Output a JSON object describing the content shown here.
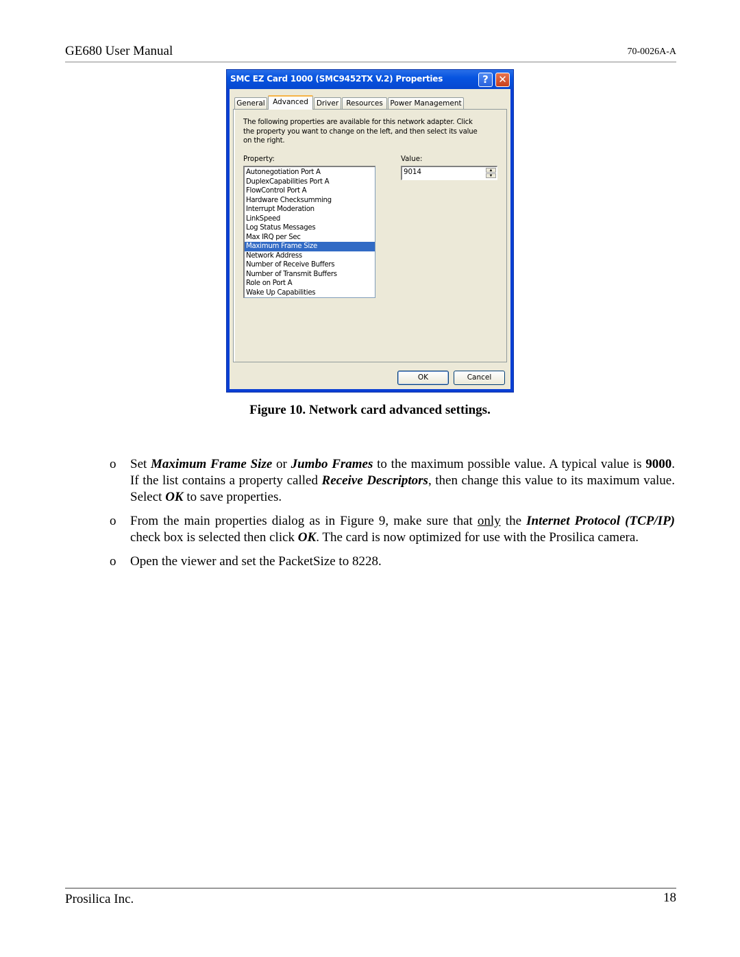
{
  "header": {
    "title": "GE680 User Manual",
    "doc_number": "70-0026A-A"
  },
  "footer": {
    "company": "Prosilica Inc.",
    "page_number": "18"
  },
  "dialog": {
    "title": "SMC EZ Card 1000 (SMC9452TX V.2) Properties",
    "help_icon": "question-mark",
    "close_icon": "x",
    "tabs": [
      {
        "label": "General",
        "active": false
      },
      {
        "label": "Advanced",
        "active": true
      },
      {
        "label": "Driver",
        "active": false
      },
      {
        "label": "Resources",
        "active": false
      },
      {
        "label": "Power Management",
        "active": false
      }
    ],
    "description": "The following properties are available for this network adapter. Click the property you want to change on the left, and then select its value on the right.",
    "property_label": "Property:",
    "value_label": "Value:",
    "properties": [
      "Autonegotiation Port A",
      "DuplexCapabilities Port A",
      "FlowControl Port A",
      "Hardware Checksumming",
      "Interrupt Moderation",
      "LinkSpeed",
      "Log Status Messages",
      "Max IRQ per Sec",
      "Maximum Frame Size",
      "Network Address",
      "Number of Receive Buffers",
      "Number of Transmit Buffers",
      "Role on Port A",
      "Wake Up Capabilities"
    ],
    "selected_property": "Maximum Frame Size",
    "value": "9014",
    "ok_label": "OK",
    "cancel_label": "Cancel"
  },
  "caption": "Figure 10. Network card advanced settings.",
  "bullets": {
    "marker": "o",
    "b1": {
      "t1": "Set ",
      "e1": "Maximum Frame Size",
      "t2": " or ",
      "e2": "Jumbo Frames",
      "t3": " to the maximum possible value. A typical value is ",
      "e3": "9000",
      "t4": ".  If the list contains a property called ",
      "e4": "Receive Descriptors",
      "t5": ", then change this value to its maximum value. Select ",
      "e5": "OK",
      "t6": " to save properties."
    },
    "b2": {
      "t1": "From the main properties dialog as in Figure 9, make sure that ",
      "u1": "only",
      "t2": " the ",
      "e1": "Internet Protocol (TCP/IP)",
      "t3": " check box is selected then click ",
      "e2": "OK",
      "t4": ".  The card is now optimized for use with the Prosilica camera."
    },
    "b3": {
      "t1": "Open the viewer and set the PacketSize to 8228."
    }
  }
}
